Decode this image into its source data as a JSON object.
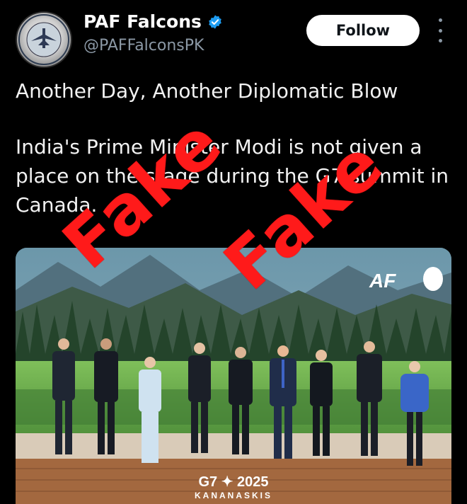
{
  "author": {
    "display_name": "PAF Falcons",
    "handle": "@PAFFalconsPK",
    "verified": true,
    "avatar_icon": "paf-falcons-emblem"
  },
  "actions": {
    "follow_label": "Follow",
    "more_icon": "more-vertical-icon"
  },
  "post": {
    "headline": "Another Day, Another Diplomatic Blow",
    "body": "India's Prime Minister Modi is not given a place on the stage during the G7 summit in Canada."
  },
  "media": {
    "watermark": "AF",
    "stage_logo_line1": "G7 ✦ 2025",
    "stage_logo_line2": "KANANASKIS",
    "people_count": 9
  },
  "overlay": {
    "stamp_text_1": "Fake",
    "stamp_text_2": "Fake",
    "stamp_color": "#ff1a1a"
  },
  "colors": {
    "background": "#000000",
    "verified_badge": "#1d9bf0",
    "handle_text": "#8b98a5"
  }
}
